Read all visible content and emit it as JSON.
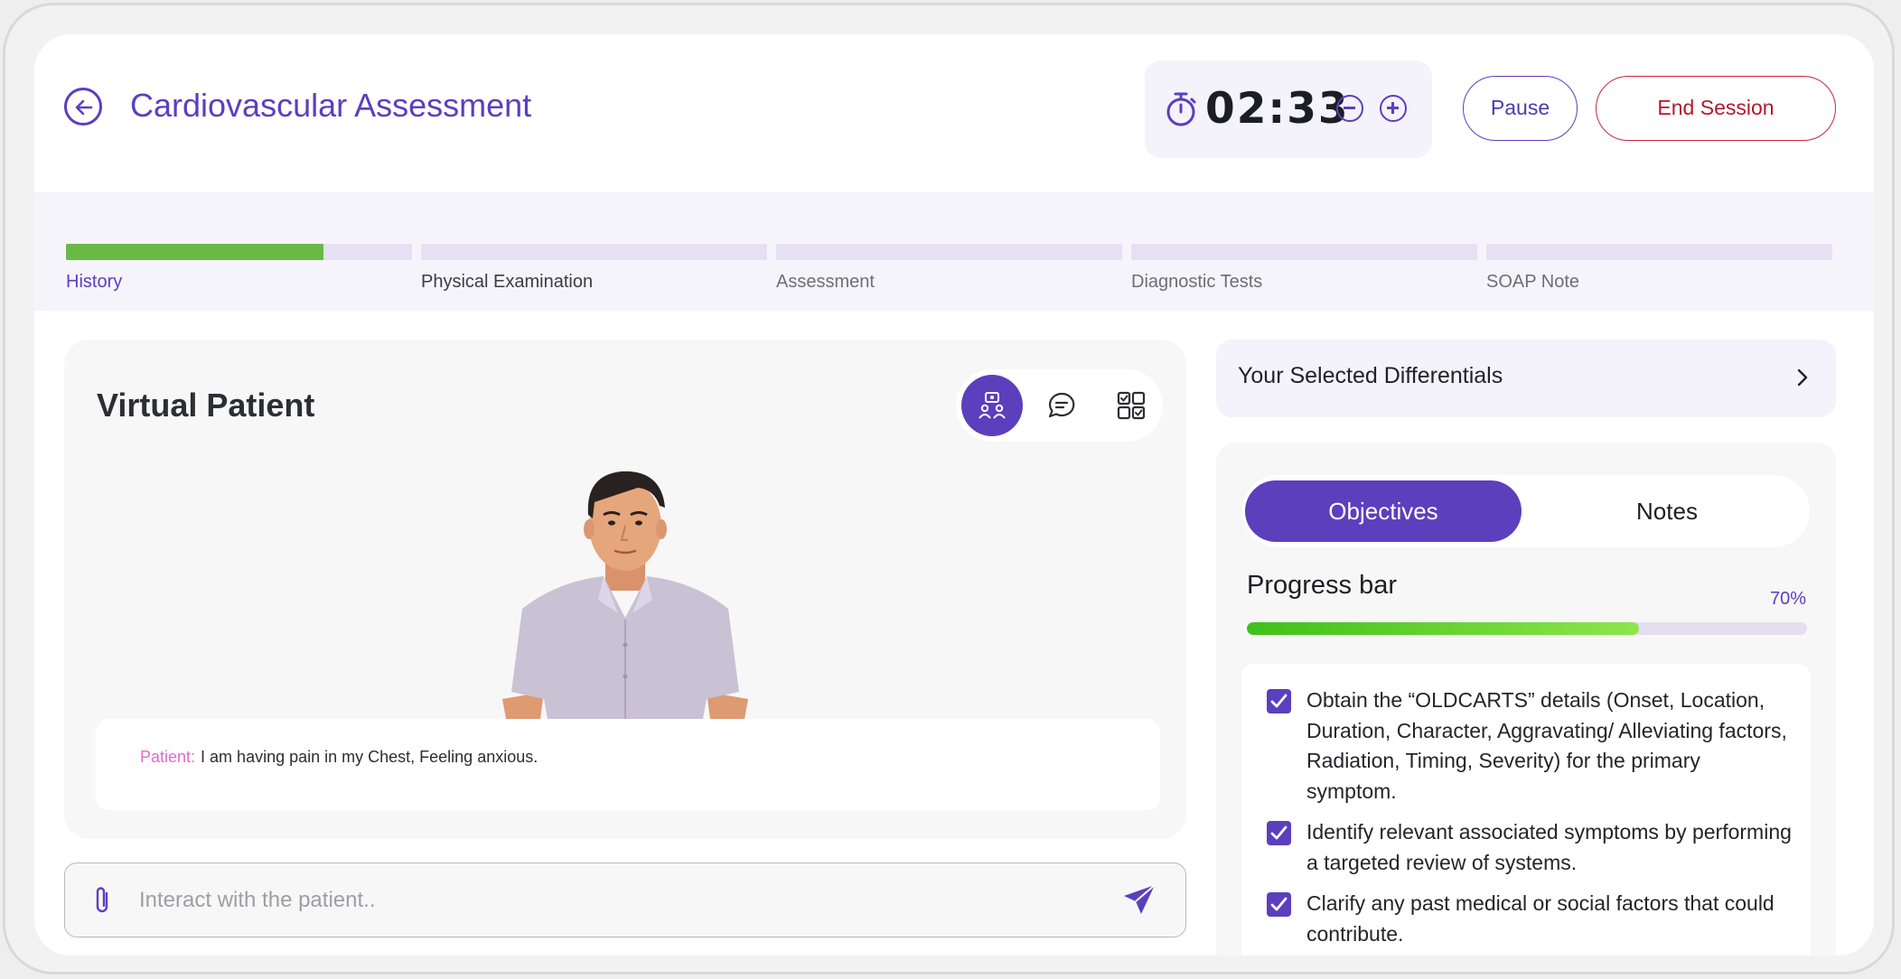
{
  "header": {
    "title": "Cardiovascular Assessment",
    "timer": "02:33",
    "pause_label": "Pause",
    "end_label": "End Session"
  },
  "steps": [
    {
      "label": "History",
      "progress": 0.745,
      "active": true
    },
    {
      "label": "Physical Examination",
      "progress": 0
    },
    {
      "label": "Assessment",
      "progress": 0
    },
    {
      "label": "Diagnostic Tests",
      "progress": 0
    },
    {
      "label": "SOAP Note",
      "progress": 0
    }
  ],
  "patient": {
    "title": "Virtual Patient",
    "tools": [
      "avatar-view-icon",
      "chat-icon",
      "checklist-icon"
    ],
    "caption_speaker": "Patient:",
    "caption_text": "I am having pain in my Chest, Feeling anxious.",
    "input_placeholder": "Interact with the patient.."
  },
  "differentials": {
    "label": "Your Selected Differentials"
  },
  "objectives": {
    "tabs": [
      "Objectives",
      "Notes"
    ],
    "progress_title": "Progress bar",
    "progress_text": "70%",
    "progress": 0.7,
    "items": [
      "Obtain the “OLDCARTS” details (Onset, Location, Duration, Character, Aggravating/ Alleviating factors, Radiation, Timing, Severity) for the primary symptom.",
      "Identify relevant associated symptoms by performing a targeted review of systems.",
      "Clarify any past medical or social factors that could contribute."
    ]
  },
  "colors": {
    "accent": "#5b3fbd",
    "danger": "#b4182c",
    "progress_green": "#6ab947",
    "speaker": "#e06ad2"
  }
}
